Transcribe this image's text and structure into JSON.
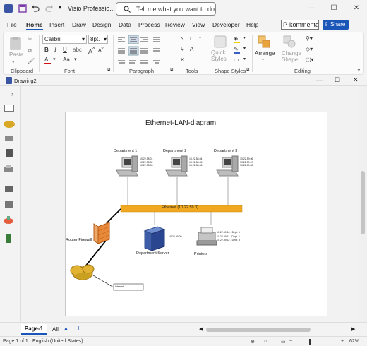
{
  "titlebar": {
    "app_title": "Visio Professio...",
    "search_placeholder": "Tell me what you want to do"
  },
  "menu": {
    "tabs": [
      "File",
      "Home",
      "Insert",
      "Draw",
      "Design",
      "Data",
      "Process",
      "Review",
      "View",
      "Developer",
      "Help"
    ],
    "comment_box": "P-kommentarer",
    "share_label": "Share"
  },
  "ribbon": {
    "clipboard": {
      "paste": "Paste",
      "label": "Clipboard"
    },
    "font": {
      "family": "Calibri",
      "size": "8pt.",
      "label": "Font"
    },
    "paragraph": {
      "label": "Paragraph"
    },
    "tools": {
      "label": "Tools"
    },
    "shape_styles": {
      "quick_styles": "Quick Styles",
      "label": "Shape Styles"
    },
    "arrange": {
      "arrange": "Arrange",
      "change_shape": "Change Shape",
      "label": "Editing"
    }
  },
  "document": {
    "tab_title": "Drawing2"
  },
  "diagram": {
    "title": "Ethernet-LAN-diagram",
    "departments": [
      {
        "label": "Department 1",
        "ips": [
          "10.22.58.01",
          "10.22.58.02",
          "10.22.58.03"
        ]
      },
      {
        "label": "Department 2",
        "ips": [
          "10.22.58.04",
          "10.22.58.05",
          "10.22.58.06"
        ]
      },
      {
        "label": "Department 3",
        "ips": [
          "10.22.59.06",
          "10.22.59.07",
          "10.22.59.08"
        ]
      }
    ],
    "ethernet_label": "Ethernet (10.22.59.0)",
    "firewall_label": "Router-Firewall",
    "server_label": "Department Server",
    "server_ip": "10.22.59.09",
    "printers_label": "Printers",
    "printer_ips": [
      "10.22.59.10 - Dept. 1",
      "10.22.59.11 - Dept. 2",
      "10.22.59.12 - Dept. 3"
    ],
    "internet_label": "Internet"
  },
  "sheet": {
    "page_tab": "Page-1",
    "all_tab": "All"
  },
  "status": {
    "page": "Page 1 of 1",
    "language": "English (United States)",
    "zoom": "62%"
  },
  "colors": {
    "accent": "#1a56b8",
    "ethernet": "#f0a820",
    "firewall": "#e8893a"
  }
}
